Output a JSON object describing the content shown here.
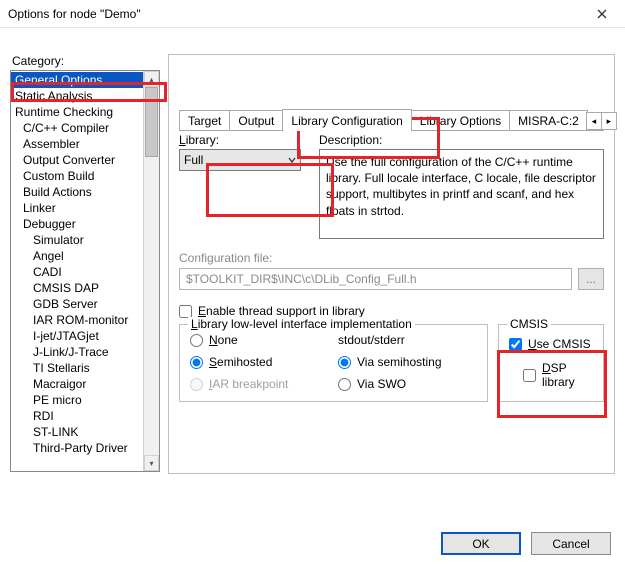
{
  "window": {
    "title": "Options for node \"Demo\""
  },
  "category": {
    "label": "Category:",
    "items": [
      {
        "label": "General Options",
        "indent": 0,
        "selected": true
      },
      {
        "label": "Static Analysis",
        "indent": 0
      },
      {
        "label": "Runtime Checking",
        "indent": 0
      },
      {
        "label": "C/C++ Compiler",
        "indent": 1
      },
      {
        "label": "Assembler",
        "indent": 1
      },
      {
        "label": "Output Converter",
        "indent": 1
      },
      {
        "label": "Custom Build",
        "indent": 1
      },
      {
        "label": "Build Actions",
        "indent": 1
      },
      {
        "label": "Linker",
        "indent": 1
      },
      {
        "label": "Debugger",
        "indent": 1
      },
      {
        "label": "Simulator",
        "indent": 2
      },
      {
        "label": "Angel",
        "indent": 2
      },
      {
        "label": "CADI",
        "indent": 2
      },
      {
        "label": "CMSIS DAP",
        "indent": 2
      },
      {
        "label": "GDB Server",
        "indent": 2
      },
      {
        "label": "IAR ROM-monitor",
        "indent": 2
      },
      {
        "label": "I-jet/JTAGjet",
        "indent": 2
      },
      {
        "label": "J-Link/J-Trace",
        "indent": 2
      },
      {
        "label": "TI Stellaris",
        "indent": 2
      },
      {
        "label": "Macraigor",
        "indent": 2
      },
      {
        "label": "PE micro",
        "indent": 2
      },
      {
        "label": "RDI",
        "indent": 2
      },
      {
        "label": "ST-LINK",
        "indent": 2
      },
      {
        "label": "Third-Party Driver",
        "indent": 2
      }
    ]
  },
  "tabs": {
    "items": [
      "Target",
      "Output",
      "Library Configuration",
      "Library Options",
      "MISRA-C:2"
    ],
    "active": 2
  },
  "library": {
    "label_prefix": "L",
    "label_rest": "ibrary:",
    "value": "Full",
    "desc_label": "Description:",
    "desc_text": "Use the full configuration of the C/C++ runtime library. Full locale interface, C locale, file descriptor support, multibytes in printf and scanf, and hex floats in strtod."
  },
  "config_file": {
    "label": "Configuration file:",
    "value": "$TOOLKIT_DIR$\\INC\\c\\DLib_Config_Full.h",
    "browse": "..."
  },
  "thread": {
    "prefix": "E",
    "rest": "nable thread support in library"
  },
  "lowlevel": {
    "legend_prefix": "L",
    "legend_rest": "ibrary low-level interface implementation",
    "left": {
      "none_prefix": "N",
      "none_rest": "one",
      "semi_prefix": "S",
      "semi_rest": "emihosted",
      "iar_prefix": "I",
      "iar_rest": "AR breakpoint"
    },
    "right": {
      "header": "stdout/stderr",
      "via_semi": "Via semihosting",
      "via_swo": "Via SWO"
    }
  },
  "cmsis": {
    "legend": "CMSIS",
    "use_prefix": "U",
    "use_rest": "se CMSIS",
    "dsp_prefix": "D",
    "dsp_rest": "SP library"
  },
  "footer": {
    "ok": "OK",
    "cancel": "Cancel"
  }
}
